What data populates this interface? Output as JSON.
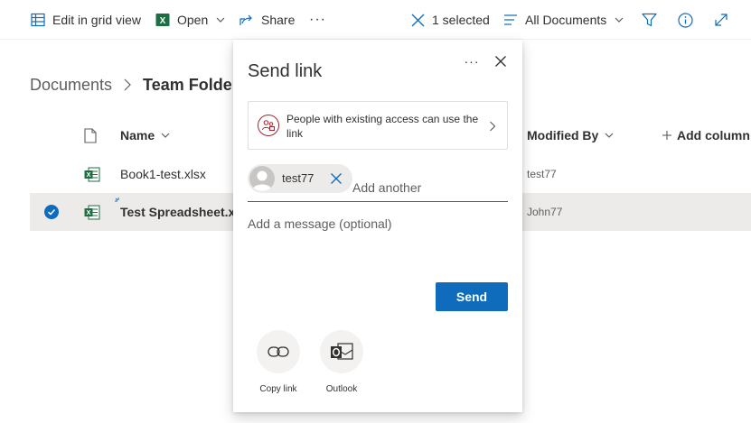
{
  "commandbar": {
    "edit_grid": "Edit in grid view",
    "open": "Open",
    "share": "Share",
    "more": "···",
    "selected": "1 selected",
    "view": "All Documents"
  },
  "breadcrumb": {
    "root": "Documents",
    "current": "Team Folder"
  },
  "list": {
    "columns": {
      "name": "Name",
      "modified_by": "Modified By",
      "add_column": "Add column"
    },
    "rows": [
      {
        "name": "Book1-test.xlsx",
        "modified_by": "test77",
        "selected": false
      },
      {
        "name": "Test Spreadsheet.xlsx",
        "modified_by": "John77",
        "selected": true
      }
    ]
  },
  "dialog": {
    "title": "Send link",
    "more": "···",
    "access_text": "People with existing access can use the link",
    "recipient": "test77",
    "add_placeholder": "Add another",
    "message_placeholder": "Add a message (optional)",
    "send_label": "Send",
    "options": [
      {
        "label": "Copy link",
        "icon": "link-icon"
      },
      {
        "label": "Outlook",
        "icon": "outlook-icon"
      }
    ]
  },
  "colors": {
    "accent": "#0f6cbd",
    "excel_green": "#1d6f42",
    "access_red": "#a4262c",
    "selected_row": "#edebe9"
  }
}
